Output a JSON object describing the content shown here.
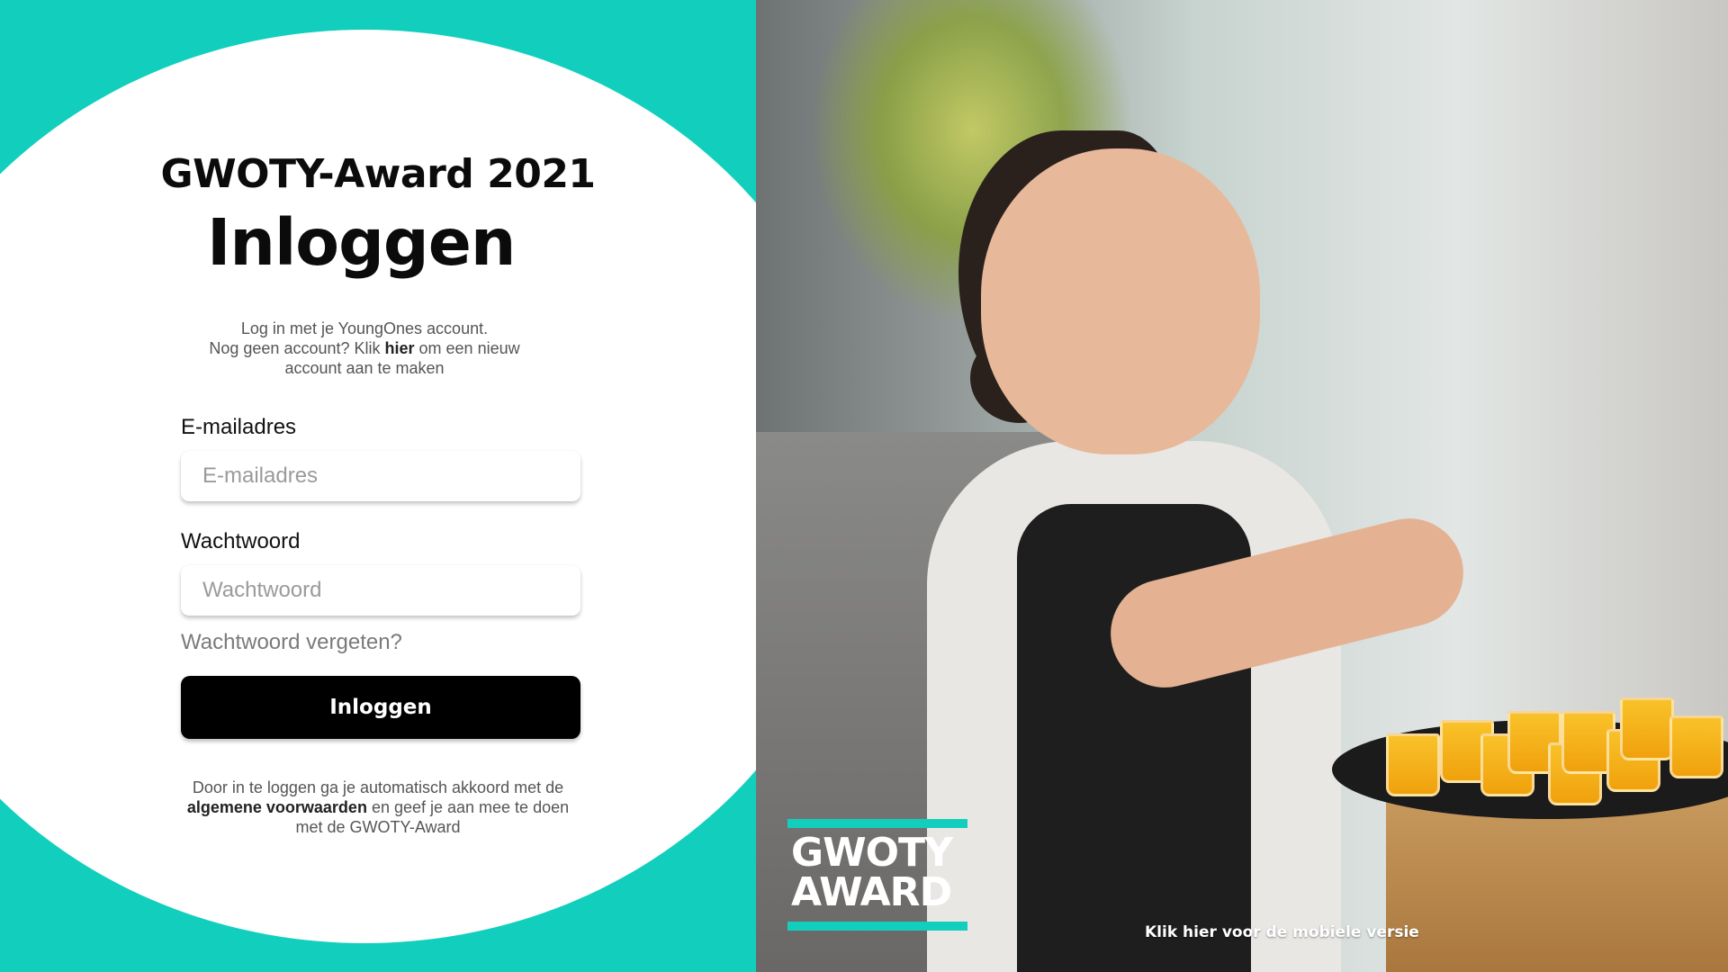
{
  "login": {
    "award_title": "GWOTY-Award 2021",
    "heading": "Inloggen",
    "intro": {
      "line1": "Log in met je YoungOnes account.",
      "line2_before": "Nog geen account? Klik ",
      "line2_link": "hier",
      "line2_after": " om een nieuw",
      "line3": "account aan te maken"
    },
    "email": {
      "label": "E-mailadres",
      "placeholder": "E-mailadres",
      "value": ""
    },
    "password": {
      "label": "Wachtwoord",
      "placeholder": "Wachtwoord",
      "value": ""
    },
    "forgot_password": "Wachtwoord vergeten?",
    "submit_label": "Inloggen",
    "terms": {
      "before": "Door in te loggen ga je automatisch akkoord met de ",
      "link": "algemene voorwaarden",
      "after": " en geef je aan mee te doen met de GWOTY-Award"
    }
  },
  "promo": {
    "logo_line1": "GWOTY",
    "logo_line2": "AWARD",
    "mobile_link": "Klik hier voor de mobiele versie"
  },
  "colors": {
    "accent": "#12cfbd",
    "button": "#000000",
    "text_muted": "#555555"
  }
}
